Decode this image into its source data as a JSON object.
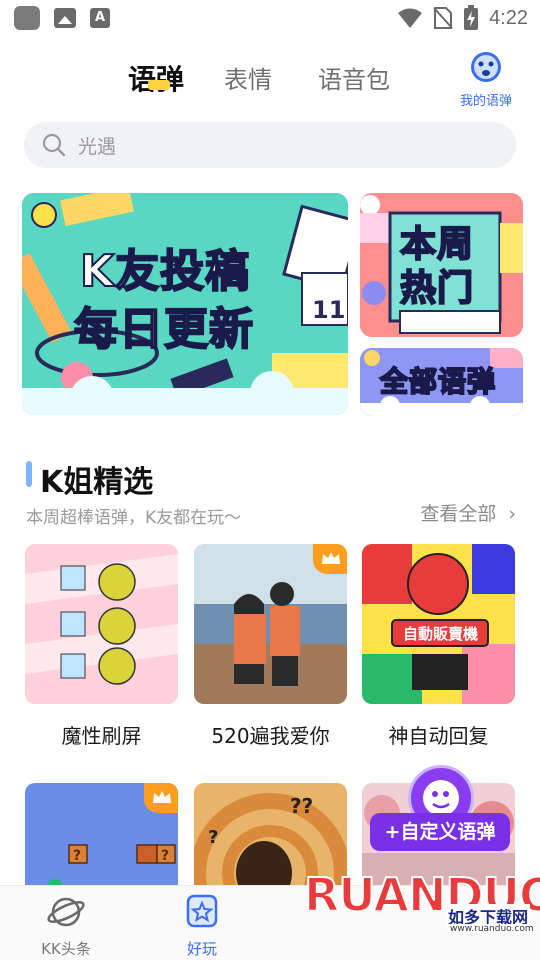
{
  "status_bar": {
    "time": "4:22"
  },
  "header": {
    "tabs": [
      {
        "label": "语弹",
        "active": true
      },
      {
        "label": "表情",
        "active": false
      },
      {
        "label": "语音包",
        "active": false
      }
    ],
    "my_label": "我的语弹"
  },
  "search": {
    "placeholder": "光遇"
  },
  "banners": {
    "main": {
      "line1": "K友投稿",
      "line2": "每日更新"
    },
    "hot": {
      "line1": "本周",
      "line2": "热门"
    },
    "all": {
      "label": "全部语弹"
    }
  },
  "section": {
    "title": "K姐精选",
    "subtitle": "本周超棒语弹，K友都在玩～",
    "more": "查看全部"
  },
  "cards": [
    {
      "title": "魔性刷屏",
      "crown": false
    },
    {
      "title": "520遍我爱你",
      "crown": true
    },
    {
      "title": "神自动回复",
      "crown": false
    },
    {
      "title": "",
      "crown": true
    },
    {
      "title": "",
      "crown": false
    },
    {
      "title": "",
      "crown": false
    }
  ],
  "vending_label": "自動販賣機",
  "float_button": {
    "label": "+自定义语弹"
  },
  "bottom_nav": [
    {
      "label": "KK头条",
      "active": false
    },
    {
      "label": "好玩",
      "active": true
    }
  ],
  "watermark": {
    "logo": "RUANDUO",
    "cn": "如多下载网",
    "url": "www.ruanduo.com"
  },
  "colors": {
    "accent_blue": "#3a6ef5",
    "tab_underline": "#ffd43a",
    "float_purple": "#7a30e6",
    "crown": "#ff9d1c"
  }
}
